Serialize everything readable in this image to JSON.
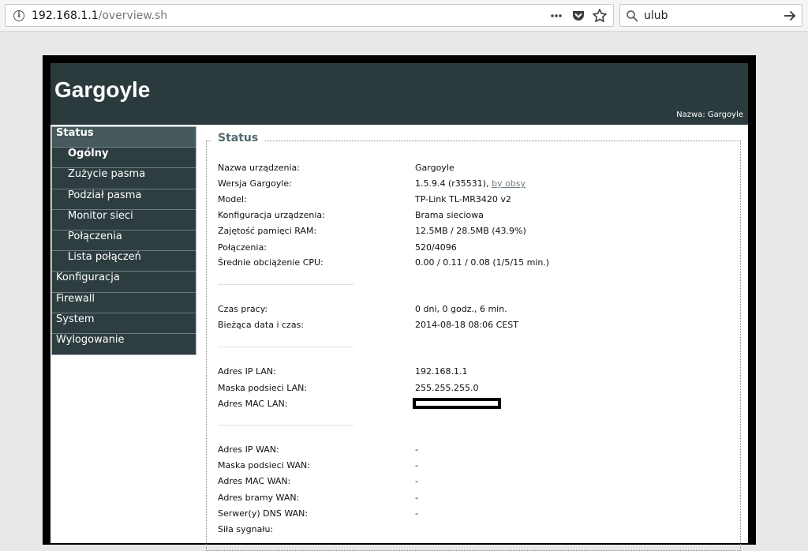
{
  "browser": {
    "url_host": "192.168.1.1",
    "url_path": "/overview.sh",
    "search_value": "ulub"
  },
  "header": {
    "brand": "Gargoyle",
    "device_name": "Nazwa: Gargoyle"
  },
  "menu": {
    "status": "Status",
    "sub_items": [
      "Ogólny",
      "Zużycie pasma",
      "Podział pasma",
      "Monitor sieci",
      "Połączenia",
      "Lista połączeń"
    ],
    "top_items": [
      "Konfiguracja",
      "Firewall",
      "System",
      "Wylogowanie"
    ]
  },
  "status": {
    "legend": "Status",
    "device_name_label": "Nazwa urządzenia:",
    "device_name_value": "Gargoyle",
    "version_label": "Wersja Gargoyle:",
    "version_value": "1.5.9.4 (r35531),",
    "version_link": "by obsy",
    "model_label": "Model:",
    "model_value": "TP-Link TL-MR3420 v2",
    "config_label": "Konfiguracja urządzenia:",
    "config_value": "Brama sieciowa",
    "ram_label": "Zajętość pamięci RAM:",
    "ram_value": "12.5MB / 28.5MB (43.9%)",
    "conn_label": "Połączenia:",
    "conn_value": "520/4096",
    "cpu_label": "Średnie obciążenie CPU:",
    "cpu_value": "0.00 / 0.11 / 0.08  (1/5/15 min.)",
    "uptime_label": "Czas pracy:",
    "uptime_value": "0 dni, 0 godz., 6 min.",
    "date_label": "Bieżąca data i czas:",
    "date_value": "2014-08-18 08:06 CEST",
    "lan_ip_label": "Adres IP LAN:",
    "lan_ip_value": "192.168.1.1",
    "lan_mask_label": "Maska podsieci LAN:",
    "lan_mask_value": "255.255.255.0",
    "lan_mac_label": "Adres MAC LAN:",
    "wan_ip_label": "Adres IP WAN:",
    "wan_ip_value": "-",
    "wan_mask_label": "Maska podsieci WAN:",
    "wan_mask_value": "-",
    "wan_mac_label": "Adres MAC WAN:",
    "wan_mac_value": "-",
    "wan_gw_label": "Adres bramy WAN:",
    "wan_gw_value": "-",
    "dns_label": "Serwer(y) DNS WAN:",
    "dns_value": "-",
    "signal_label": "Siła sygnału:"
  }
}
